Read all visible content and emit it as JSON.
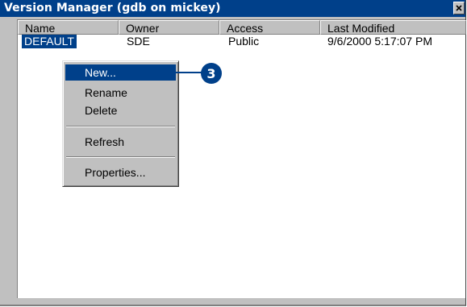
{
  "window": {
    "title": "Version Manager (gdb on mickey)",
    "close_glyph": "x"
  },
  "columns": [
    "Name",
    "Owner",
    "Access",
    "Last Modified"
  ],
  "rows": [
    {
      "name": "DEFAULT",
      "owner": "SDE",
      "access": "Public",
      "modified": "9/6/2000 5:17:07 PM"
    }
  ],
  "context_menu": {
    "items": [
      "New...",
      "Rename",
      "Delete",
      "Refresh",
      "Properties..."
    ],
    "highlighted": "New..."
  },
  "callout": {
    "number": "3"
  },
  "colors": {
    "accent": "#00408a",
    "face": "#c0c0c0"
  }
}
